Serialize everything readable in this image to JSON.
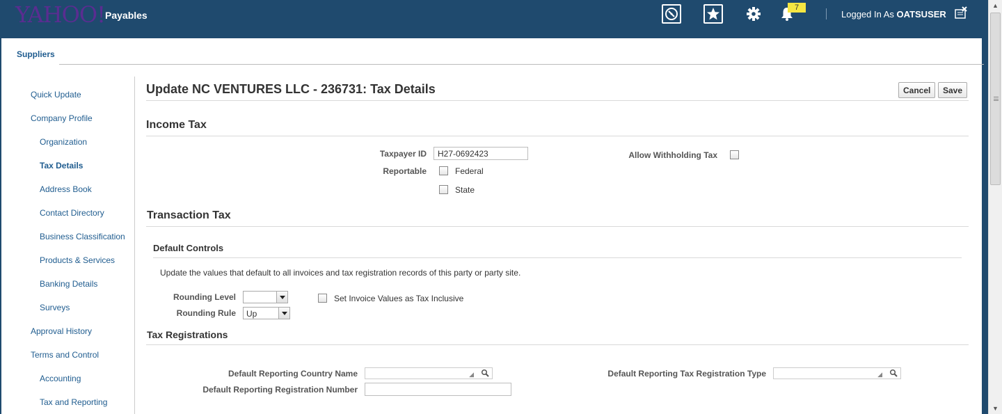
{
  "header": {
    "logo_text": "YAHOO!",
    "app_title": "Payables",
    "icons": [
      "compass-icon",
      "favorites-star-icon",
      "settings-gear-icon",
      "notifications-bell-icon",
      "close-window-icon"
    ],
    "notification_count": "7",
    "logged_in_prefix": "Logged In As",
    "username": "OATSUSER",
    "colors": {
      "bar": "#1f4a6e",
      "logo": "#5a2d91",
      "badge": "#f5e642"
    }
  },
  "tabs": {
    "suppliers": "Suppliers"
  },
  "sidebar": {
    "items": [
      {
        "label": "Quick Update"
      },
      {
        "label": "Company Profile"
      },
      {
        "label": "Organization"
      },
      {
        "label": "Tax Details",
        "selected": true
      },
      {
        "label": "Address Book"
      },
      {
        "label": "Contact Directory"
      },
      {
        "label": "Business Classification"
      },
      {
        "label": "Products & Services"
      },
      {
        "label": "Banking Details"
      },
      {
        "label": "Surveys"
      },
      {
        "label": "Approval History"
      },
      {
        "label": "Terms and Control"
      },
      {
        "label": "Accounting"
      },
      {
        "label": "Tax and Reporting"
      }
    ]
  },
  "page": {
    "title": "Update NC VENTURES LLC - 236731: Tax Details",
    "cancel_label": "Cancel",
    "save_label": "Save"
  },
  "income_tax": {
    "heading": "Income Tax",
    "taxpayer_id_label": "Taxpayer ID",
    "taxpayer_id_value": "H27-0692423",
    "reportable_label": "Reportable",
    "federal_label": "Federal",
    "federal_checked": false,
    "state_label": "State",
    "state_checked": false,
    "allow_withholding_label": "Allow Withholding Tax",
    "allow_withholding_checked": false
  },
  "transaction_tax": {
    "heading": "Transaction Tax",
    "default_controls_heading": "Default Controls",
    "description": "Update the values that default to all invoices and tax registration records of this party or party site.",
    "rounding_level_label": "Rounding Level",
    "rounding_level_value": "",
    "rounding_rule_label": "Rounding Rule",
    "rounding_rule_value": "Up",
    "tax_inclusive_label": "Set Invoice Values as Tax Inclusive",
    "tax_inclusive_checked": false
  },
  "tax_registrations": {
    "heading": "Tax Registrations",
    "country_label": "Default Reporting Country Name",
    "country_value": "",
    "registration_number_label": "Default Reporting Registration Number",
    "registration_number_value": "",
    "registration_type_label": "Default Reporting Tax Registration Type",
    "registration_type_value": ""
  }
}
